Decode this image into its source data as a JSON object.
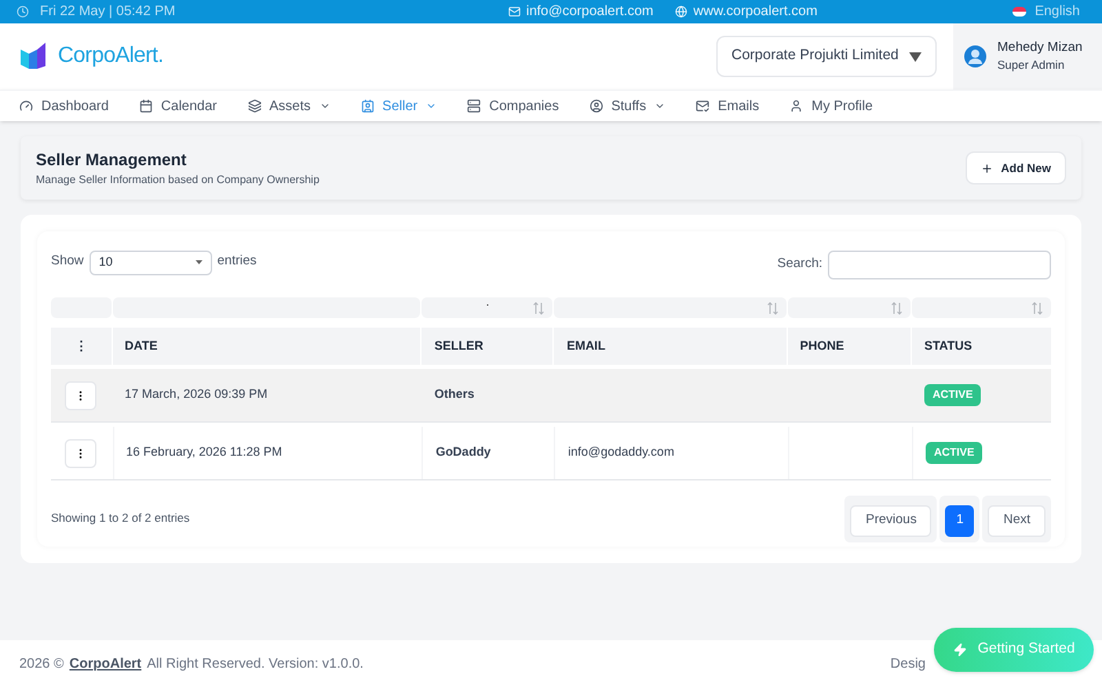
{
  "topbar": {
    "datetime": "Fri 22 May | 05:42 PM",
    "email": "info@corpoalert.com",
    "website": "www.corpoalert.com",
    "language": "English"
  },
  "header": {
    "logo_text": "CorpoAlert.",
    "company_select": "Corporate Projukti Limited",
    "user": {
      "name": "Mehedy Mizan",
      "role": "Super Admin"
    }
  },
  "nav": [
    {
      "label": "Dashboard",
      "dropdown": false,
      "selected": false
    },
    {
      "label": "Calendar",
      "dropdown": false,
      "selected": false
    },
    {
      "label": "Assets",
      "dropdown": true,
      "selected": false
    },
    {
      "label": "Seller",
      "dropdown": true,
      "selected": true
    },
    {
      "label": "Companies",
      "dropdown": false,
      "selected": false
    },
    {
      "label": "Stuffs",
      "dropdown": true,
      "selected": false
    },
    {
      "label": "Emails",
      "dropdown": false,
      "selected": false
    },
    {
      "label": "My Profile",
      "dropdown": false,
      "selected": false
    }
  ],
  "page_header": {
    "title": "Seller Management",
    "subtitle": "Manage Seller Information based on Company Ownership",
    "add_button": "Add New"
  },
  "table": {
    "show_label": "Show",
    "page_size": "10",
    "entries_label": "entries",
    "search_label": "Search:",
    "filter_dot": ".",
    "columns": [
      "⋮",
      "DATE",
      "SELLER",
      "EMAIL",
      "PHONE",
      "STATUS"
    ],
    "rows": [
      {
        "date": "17 March, 2026 09:39 PM",
        "seller": "Others",
        "status": "ACTIVE",
        "highlighted": true
      },
      {
        "date": "16 February, 2026 11:28 PM",
        "seller": "GoDaddy",
        "email": "info@godaddy.com",
        "status": "ACTIVE",
        "highlighted": false
      }
    ],
    "info": "Showing 1 to 2 of 2 entries",
    "pagination": [
      {
        "label": "Previous",
        "kind": "nav",
        "selected": false
      },
      {
        "label": "1",
        "kind": "page",
        "selected": true
      },
      {
        "label": "Next",
        "kind": "nav",
        "selected": false
      }
    ]
  },
  "footer": {
    "copyright_prefix": "2026 ©",
    "brand_link": "CorpoAlert",
    "copyright_suffix": "All Right Reserved. Version: v1.0.0.",
    "right_text": "Desig"
  },
  "getting_started": "Getting Started"
}
